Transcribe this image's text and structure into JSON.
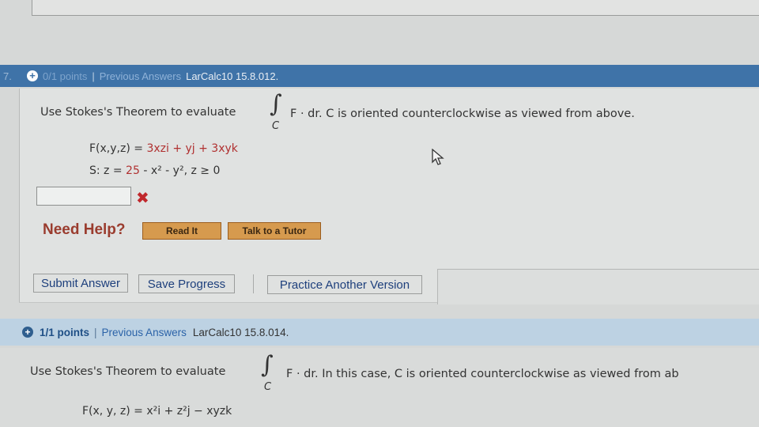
{
  "q7": {
    "number": "7.",
    "points": "0/1 points",
    "sep": "|",
    "previous_answers": "Previous Answers",
    "ref": "LarCalc10 15.8.012.",
    "prompt_start": "Use Stokes's Theorem to evaluate",
    "integral_symbol": "∫",
    "integral_sub": "C",
    "prompt_end": "F · dr.  C is oriented counterclockwise as viewed from above.",
    "field_F_lhs": "F(x,y,z) = ",
    "field_F_rhs": "3xzi + yj + 3xyk",
    "surface_lhs": "S: z = ",
    "surface_red": "25",
    "surface_rhs": " - x² - y², z ≥ 0",
    "answer_value": "",
    "status_icon": "✖",
    "need_help": "Need Help?",
    "read_it": "Read It",
    "talk_to_tutor": "Talk to a Tutor",
    "submit": "Submit Answer",
    "save": "Save Progress",
    "practice": "Practice Another Version"
  },
  "q8": {
    "plus": "+",
    "points": "1/1 points",
    "sep": "|",
    "previous_answers": "Previous Answers",
    "ref": "LarCalc10 15.8.014.",
    "prompt_start": "Use Stokes's Theorem to evaluate",
    "integral_symbol": "∫",
    "integral_sub": "C",
    "prompt_end": "F · dr.  In this case, C is oriented counterclockwise as viewed from ab",
    "field_F": "F(x, y, z) = x²i + z²j − xyzk"
  },
  "icons": {
    "plus": "+",
    "cursor": "arrow-cursor"
  }
}
